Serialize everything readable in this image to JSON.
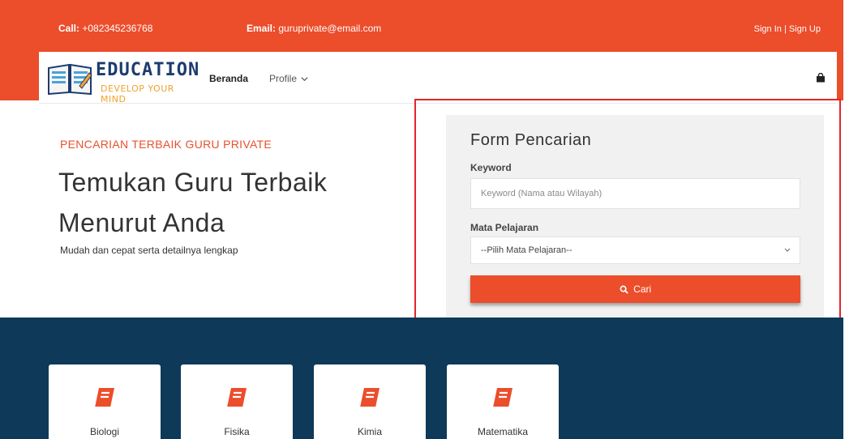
{
  "topbar": {
    "call_label": "Call:",
    "call_value": "+082345236768",
    "email_label": "Email:",
    "email_value": "guruprivate@email.com",
    "sign_in": "Sign In",
    "separator": "|",
    "sign_up": "Sign Up"
  },
  "logo": {
    "title": "EDUCATION",
    "tagline": "DEVELOP YOUR MIND"
  },
  "nav": {
    "home": "Beranda",
    "profile": "Profile"
  },
  "hero": {
    "subtitle": "PENCARIAN TERBAIK GURU PRIVATE",
    "title": "Temukan Guru Terbaik Menurut Anda",
    "description": "Mudah dan cepat serta detailnya lengkap"
  },
  "search_form": {
    "title": "Form Pencarian",
    "keyword_label": "Keyword",
    "keyword_placeholder": "Keyword (Nama atau Wilayah)",
    "keyword_value": "",
    "subject_label": "Mata Pelajaran",
    "subject_selected": "--Pilih Mata Pelajaran--",
    "submit_label": "Cari"
  },
  "subjects": [
    {
      "name": "Biologi",
      "icon": "book-icon"
    },
    {
      "name": "Fisika",
      "icon": "book-icon"
    },
    {
      "name": "Kimia",
      "icon": "book-icon"
    },
    {
      "name": "Matematika",
      "icon": "book-icon"
    }
  ],
  "colors": {
    "brand": "#ec4d2b",
    "dark": "#0e3959",
    "highlight": "#e3252b"
  }
}
